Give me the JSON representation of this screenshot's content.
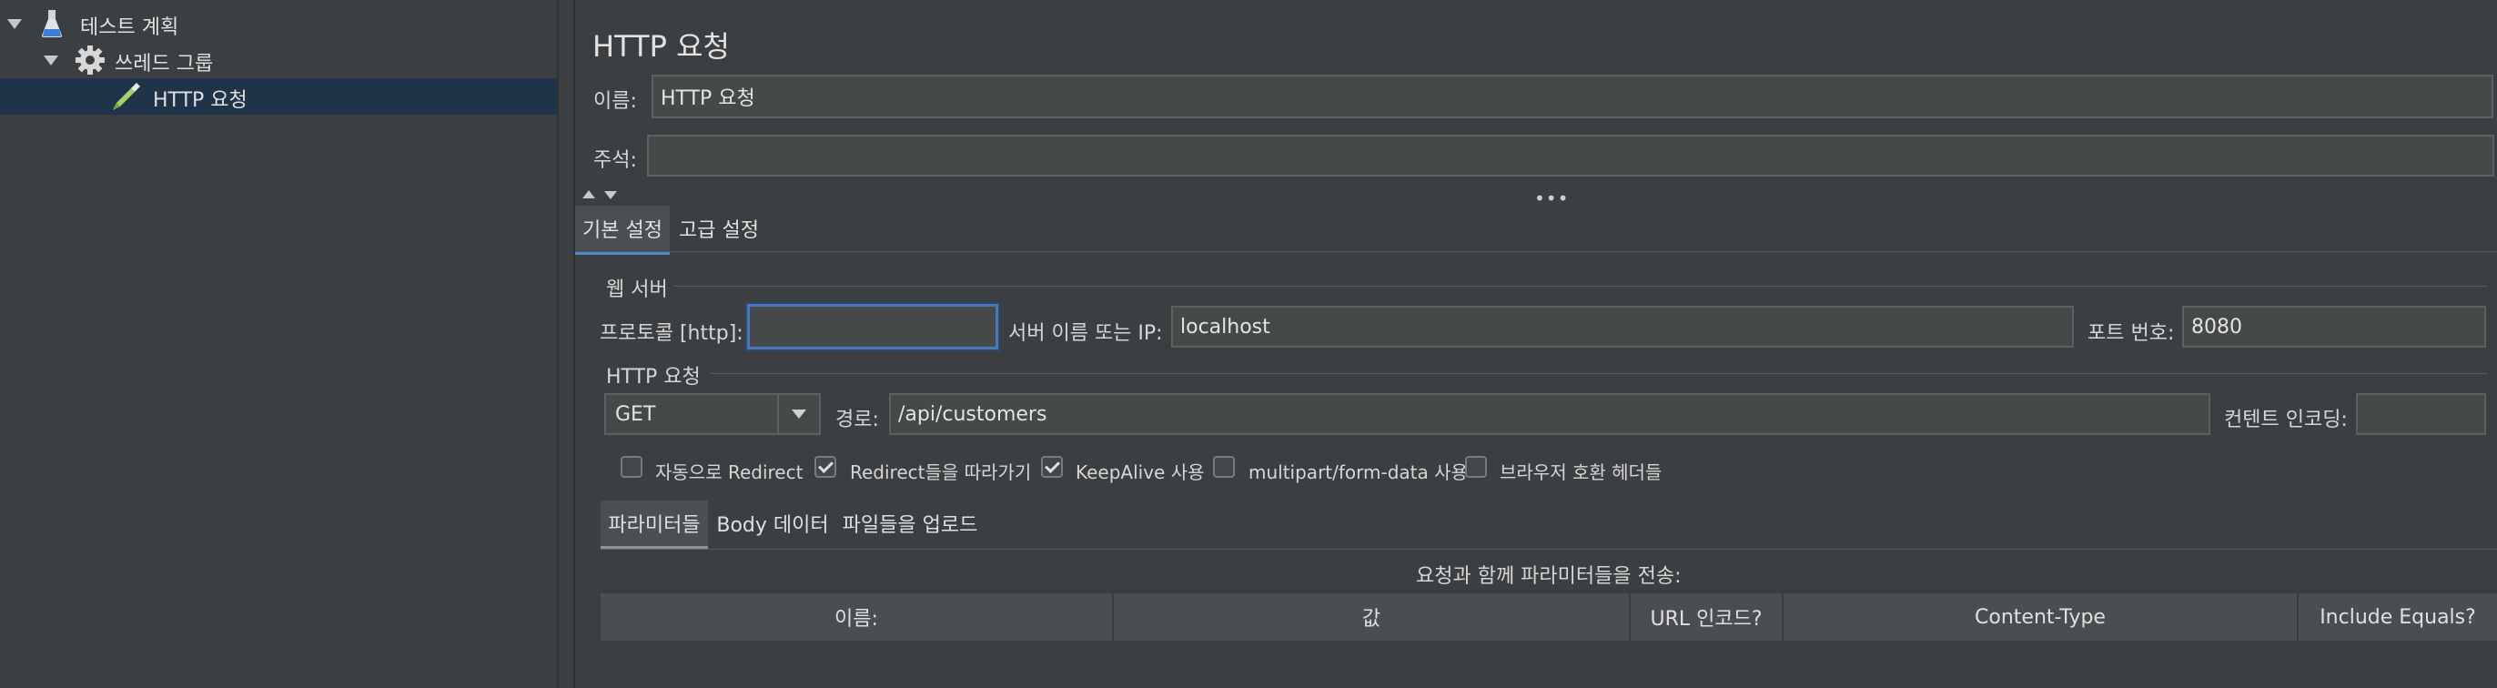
{
  "tree": {
    "items": [
      {
        "label": "테스트 계획",
        "icon": "flask-icon",
        "expanded": true
      },
      {
        "label": "쓰레드 그룹",
        "icon": "gear-icon",
        "expanded": true
      },
      {
        "label": "HTTP 요청",
        "icon": "pipette-icon",
        "selected": true
      }
    ]
  },
  "main": {
    "title": "HTTP 요청",
    "name_label": "이름:",
    "name_value": "HTTP 요청",
    "comment_label": "주석:",
    "comment_value": "",
    "tabs": [
      {
        "label": "기본 설정",
        "active": true
      },
      {
        "label": "고급 설정",
        "active": false
      }
    ],
    "web_server": {
      "group_label": "웹 서버",
      "protocol_label": "프로토콜 [http]:",
      "protocol_value": "",
      "server_label": "서버 이름 또는 IP:",
      "server_value": "localhost",
      "port_label": "포트 번호:",
      "port_value": "8080"
    },
    "http_request": {
      "group_label": "HTTP 요청",
      "method": "GET",
      "path_label": "경로:",
      "path_value": "/api/customers",
      "encoding_label": "컨텐트 인코딩:",
      "encoding_value": ""
    },
    "checkboxes": [
      {
        "label": "자동으로 Redirect",
        "checked": false
      },
      {
        "label": "Redirect들을 따라가기",
        "checked": true
      },
      {
        "label": "KeepAlive 사용",
        "checked": true
      },
      {
        "label": "multipart/form-data 사용",
        "checked": false
      },
      {
        "label": "브라우저 호환 헤더들",
        "checked": false
      }
    ],
    "sub_tabs": [
      {
        "label": "파라미터들",
        "active": true
      },
      {
        "label": "Body 데이터",
        "active": false
      },
      {
        "label": "파일들을 업로드",
        "active": false
      }
    ],
    "params_caption": "요청과 함께 파라미터들을 전송:",
    "table_headers": [
      "이름:",
      "값",
      "URL 인코드?",
      "Content-Type",
      "Include Equals?"
    ]
  },
  "colors": {
    "background": "#3c3f41",
    "selection": "#1f3349",
    "accent": "#4a88c7"
  }
}
